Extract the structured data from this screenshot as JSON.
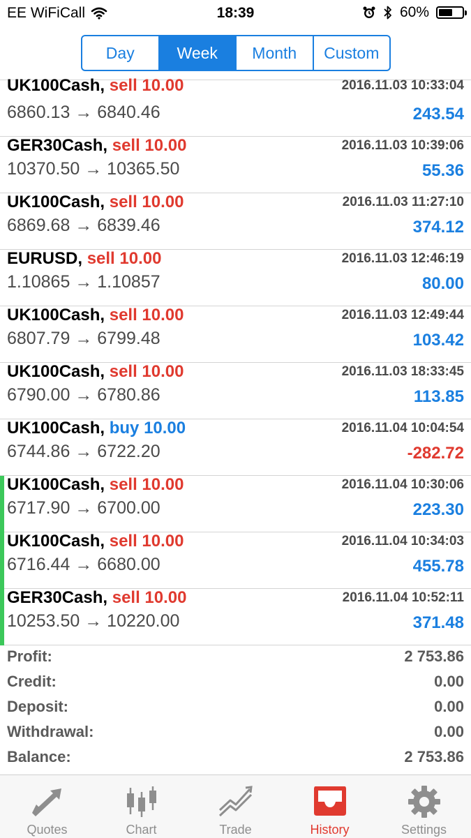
{
  "status_bar": {
    "carrier": "EE WiFiCall",
    "time": "18:39",
    "battery_text": "60%",
    "battery_level": 0.6
  },
  "period_tabs": [
    {
      "label": "Day",
      "active": false
    },
    {
      "label": "Week",
      "active": true
    },
    {
      "label": "Month",
      "active": false
    },
    {
      "label": "Custom",
      "active": false
    }
  ],
  "trades": [
    {
      "symbol": "UK100Cash,",
      "side": "sell",
      "side_text": "sell 10.00",
      "time": "2016.11.03 10:33:04",
      "prices": "6860.13 → 6840.46",
      "profit": "243.54",
      "negative": false,
      "marked": false
    },
    {
      "symbol": "GER30Cash,",
      "side": "sell",
      "side_text": "sell 10.00",
      "time": "2016.11.03 10:39:06",
      "prices": "10370.50 → 10365.50",
      "profit": "55.36",
      "negative": false,
      "marked": false
    },
    {
      "symbol": "UK100Cash,",
      "side": "sell",
      "side_text": "sell 10.00",
      "time": "2016.11.03 11:27:10",
      "prices": "6869.68 → 6839.46",
      "profit": "374.12",
      "negative": false,
      "marked": false
    },
    {
      "symbol": "EURUSD,",
      "side": "sell",
      "side_text": "sell 10.00",
      "time": "2016.11.03 12:46:19",
      "prices": "1.10865 → 1.10857",
      "profit": "80.00",
      "negative": false,
      "marked": false
    },
    {
      "symbol": "UK100Cash,",
      "side": "sell",
      "side_text": "sell 10.00",
      "time": "2016.11.03 12:49:44",
      "prices": "6807.79 → 6799.48",
      "profit": "103.42",
      "negative": false,
      "marked": false
    },
    {
      "symbol": "UK100Cash,",
      "side": "sell",
      "side_text": "sell 10.00",
      "time": "2016.11.03 18:33:45",
      "prices": "6790.00 → 6780.86",
      "profit": "113.85",
      "negative": false,
      "marked": false
    },
    {
      "symbol": "UK100Cash,",
      "side": "buy",
      "side_text": "buy 10.00",
      "time": "2016.11.04 10:04:54",
      "prices": "6744.86 → 6722.20",
      "profit": "-282.72",
      "negative": true,
      "marked": false
    },
    {
      "symbol": "UK100Cash,",
      "side": "sell",
      "side_text": "sell 10.00",
      "time": "2016.11.04 10:30:06",
      "prices": "6717.90 → 6700.00",
      "profit": "223.30",
      "negative": false,
      "marked": true
    },
    {
      "symbol": "UK100Cash,",
      "side": "sell",
      "side_text": "sell 10.00",
      "time": "2016.11.04 10:34:03",
      "prices": "6716.44 → 6680.00",
      "profit": "455.78",
      "negative": false,
      "marked": true
    },
    {
      "symbol": "GER30Cash,",
      "side": "sell",
      "side_text": "sell 10.00",
      "time": "2016.11.04 10:52:11",
      "prices": "10253.50 → 10220.00",
      "profit": "371.48",
      "negative": false,
      "marked": true
    }
  ],
  "summary": [
    {
      "label": "Profit:",
      "value": "2 753.86"
    },
    {
      "label": "Credit:",
      "value": "0.00"
    },
    {
      "label": "Deposit:",
      "value": "0.00"
    },
    {
      "label": "Withdrawal:",
      "value": "0.00"
    },
    {
      "label": "Balance:",
      "value": "2 753.86"
    }
  ],
  "tab_bar": [
    {
      "label": "Quotes",
      "icon": "quotes-arrows-icon",
      "active": false
    },
    {
      "label": "Chart",
      "icon": "candlestick-chart-icon",
      "active": false
    },
    {
      "label": "Trade",
      "icon": "trend-lines-icon",
      "active": false
    },
    {
      "label": "History",
      "icon": "inbox-tray-icon",
      "active": true
    },
    {
      "label": "Settings",
      "icon": "gear-icon",
      "active": false
    }
  ],
  "colors": {
    "accent_blue": "#1a7fe0",
    "sell_red": "#e03a2f",
    "marker_green": "#3cc85a",
    "tab_inactive": "#8e8e8e"
  }
}
